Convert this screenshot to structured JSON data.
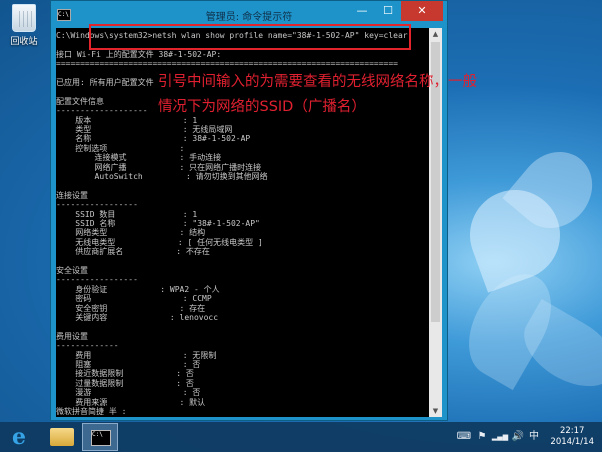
{
  "desktop": {
    "recycle_bin_label": "回收站"
  },
  "window": {
    "title": "管理员: 命令提示符",
    "icon_text": "C:\\",
    "min_glyph": "—",
    "max_glyph": "☐",
    "close_glyph": "✕"
  },
  "console": {
    "lines": [
      "C:\\Windows\\system32>netsh wlan show profile name=\"38#-1-502-AP\" key=clear",
      "",
      "接口 Wi-Fi 上的配置文件 38#-1-502-AP:",
      "=======================================================================",
      "",
      "已应用: 所有用户配置文件",
      "",
      "配置文件信息",
      "-------------------",
      "    版本                   : 1",
      "    类型                   : 无线局域网",
      "    名称                   : 38#-1-502-AP",
      "    控制选项               :",
      "        连接模式           : 手动连接",
      "        网络广播           : 只在网络广播时连接",
      "        AutoSwitch         : 请勿切换到其他网络",
      "",
      "连接设置",
      "-----------------",
      "    SSID 数目              : 1",
      "    SSID 名称              : \"38#-1-502-AP\"",
      "    网络类型               : 结构",
      "    无线电类型             : [ 任何无线电类型 ]",
      "    供应商扩展名           : 不存在",
      "",
      "安全设置",
      "-----------------",
      "    身份验证           : WPA2 - 个人",
      "    密码                   : CCMP",
      "    安全密钥               : 存在",
      "    关键内容             : lenovocc",
      "",
      "费用设置",
      "-------------",
      "    费用                   : 无限制",
      "    阻塞                   : 否",
      "    接近数据限制           : 否",
      "    过量数据限制           : 否",
      "    漫游                   : 否",
      "    费用来源               : 默认",
      "微软拼音简捷 半 :"
    ]
  },
  "annotation": {
    "line1": "引号中间输入的为需要查看的无线网络名称，一般",
    "line2": "情况下为网络的SSID（广播名）"
  },
  "taskbar": {
    "ie_glyph": "e",
    "cmd_icon_text": "C:\\",
    "tray_keyboard_glyph": "⌨",
    "tray_flag_glyph": "⚑",
    "tray_signal_glyph": "▂▄▆",
    "tray_volume_glyph": "🔊",
    "tray_lang": "中",
    "time": "22:17",
    "date": "2014/1/14"
  }
}
